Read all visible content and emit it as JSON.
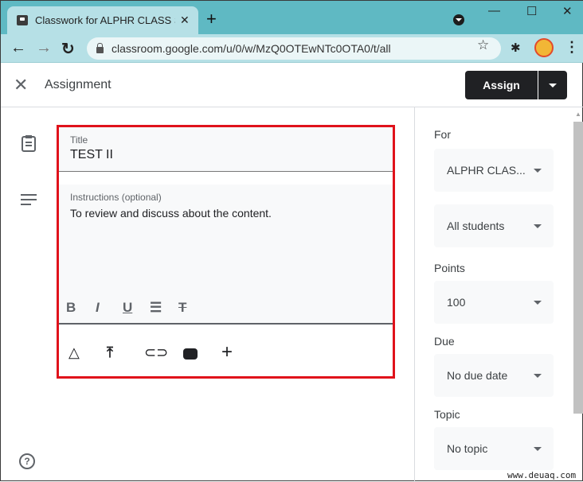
{
  "browser": {
    "tab_title": "Classwork for ALPHR CLASS SAMPLE",
    "url": "classroom.google.com/u/0/w/MzQ0OTEwNTc0OTA0/t/all"
  },
  "header": {
    "title": "Assignment",
    "assign_label": "Assign"
  },
  "form": {
    "title_label": "Title",
    "title_value": "TEST II",
    "instructions_label": "Instructions (optional)",
    "instructions_value": "To review and discuss about the content."
  },
  "sidebar": {
    "for_label": "For",
    "class_value": "ALPHR CLAS...",
    "students_value": "All students",
    "points_label": "Points",
    "points_value": "100",
    "due_label": "Due",
    "due_value": "No due date",
    "topic_label": "Topic",
    "topic_value": "No topic"
  },
  "watermark": "www.deuaq.com"
}
